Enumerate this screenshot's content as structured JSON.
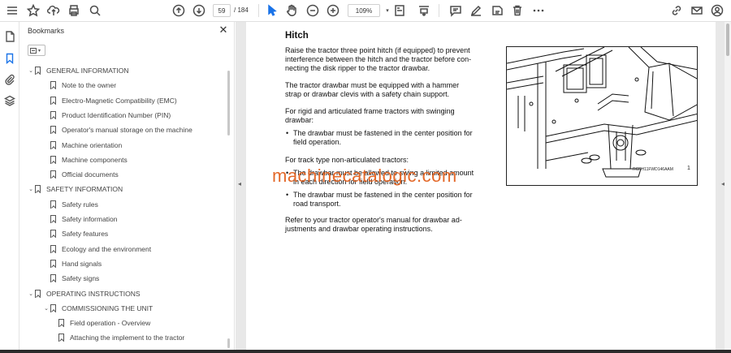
{
  "toolbar": {
    "page_current": "59",
    "page_total": "/ 184",
    "zoom": "109%"
  },
  "bookmarks_panel": {
    "title": "Bookmarks",
    "items": [
      {
        "label": "GENERAL INFORMATION",
        "level": 0,
        "expanded": true
      },
      {
        "label": "Note to the owner",
        "level": 1
      },
      {
        "label": "Electro-Magnetic Compatibility (EMC)",
        "level": 1
      },
      {
        "label": "Product Identification Number (PIN)",
        "level": 1
      },
      {
        "label": "Operator's manual storage on the machine",
        "level": 1
      },
      {
        "label": "Machine orientation",
        "level": 1
      },
      {
        "label": "Machine components",
        "level": 1
      },
      {
        "label": "Official documents",
        "level": 1
      },
      {
        "label": "SAFETY INFORMATION",
        "level": 0,
        "expanded": true
      },
      {
        "label": "Safety rules",
        "level": 1
      },
      {
        "label": "Safety information",
        "level": 1
      },
      {
        "label": "Safety features",
        "level": 1
      },
      {
        "label": "Ecology and the environment",
        "level": 1
      },
      {
        "label": "Hand signals",
        "level": 1
      },
      {
        "label": "Safety signs",
        "level": 1
      },
      {
        "label": "OPERATING INSTRUCTIONS",
        "level": 0,
        "expanded": true
      },
      {
        "label": "COMMISSIONING THE UNIT",
        "level": 1,
        "expanded": true
      },
      {
        "label": "Field operation - Overview",
        "level": 2
      },
      {
        "label": "Attaching the implement to the tractor",
        "level": 2
      }
    ]
  },
  "document": {
    "heading": "Hitch",
    "para1": [
      "Raise the tractor three point hitch (if equipped) to prevent",
      "interference between the hitch and the tractor before con-",
      "necting the disk ripper to the tractor drawbar."
    ],
    "para2": [
      "The tractor drawbar must be equipped with a hammer",
      "strap or drawbar clevis with a safety chain support."
    ],
    "para3": [
      "For rigid and articulated frame tractors with swinging",
      "drawbar:"
    ],
    "bullet1": [
      "The drawbar must be fastened in the center position for",
      "field operation."
    ],
    "para4": [
      "For track type non-articulated tractors:"
    ],
    "bullet2": [
      "The drawbar must be allowed to swing a limited amount",
      "in each direction for field operation."
    ],
    "bullet3": [
      "The drawbar must be fastened in the center position for",
      "road transport."
    ],
    "para5": [
      "Refer to your tractor operator's manual for drawbar ad-",
      "justments and drawbar operating instructions."
    ],
    "figure_caption": "RCPH11FWD146AAM",
    "figure_number": "1",
    "watermark": "machinecatalogic.com"
  },
  "icons": [
    "star-icon",
    "upload-icon",
    "print-icon",
    "zoom-search-icon",
    "page-up-icon",
    "page-down-icon",
    "select-cursor-icon",
    "hand-icon",
    "zoom-out-icon",
    "zoom-in-icon",
    "fit-page-icon",
    "scroll-mode-icon",
    "comment-icon",
    "draw-icon",
    "highlight-icon",
    "delete-icon",
    "more-icon",
    "share-link-icon",
    "email-icon",
    "account-icon"
  ]
}
